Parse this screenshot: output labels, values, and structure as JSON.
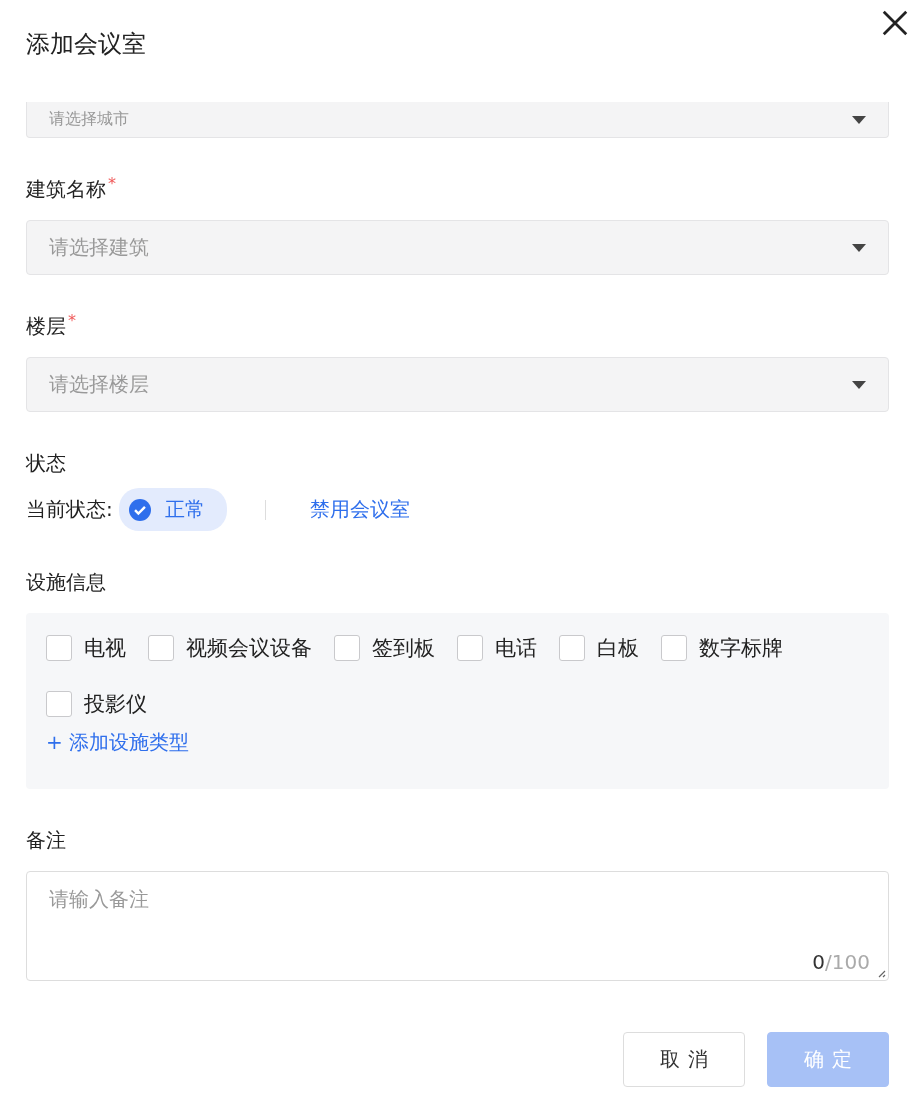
{
  "dialog": {
    "title": "添加会议室"
  },
  "fields": [
    {
      "kind": "select",
      "placeholder": "请选择城市"
    },
    {
      "kind": "select",
      "label": "建筑名称",
      "mark": "*",
      "placeholder": "请选择建筑"
    },
    {
      "kind": "select",
      "label": "楼层",
      "mark": "*",
      "placeholder": "请选择楼层"
    }
  ],
  "status": {
    "label": "状态",
    "prefix": "当前状态:",
    "current": "正常",
    "enabled": true,
    "action": "禁用会议室"
  },
  "facilities": {
    "label": "设施信息",
    "items": [
      {
        "label": "电视",
        "checked": false
      },
      {
        "label": "视频会议设备",
        "checked": false
      },
      {
        "label": "签到板",
        "checked": false
      },
      {
        "label": "电话",
        "checked": false
      },
      {
        "label": "白板",
        "checked": false
      },
      {
        "label": "数字标牌",
        "checked": false
      },
      {
        "label": "投影仪",
        "checked": false
      }
    ],
    "add": "+ 添加设施类型"
  },
  "remark": {
    "label": "备注",
    "placeholder": "请输入备注",
    "count": "0",
    "limit": "/100"
  },
  "buttons": [
    {
      "label": "取消",
      "kind": "secondary",
      "disabled": false
    },
    {
      "label": "确定",
      "kind": "primary",
      "disabled": true
    }
  ]
}
